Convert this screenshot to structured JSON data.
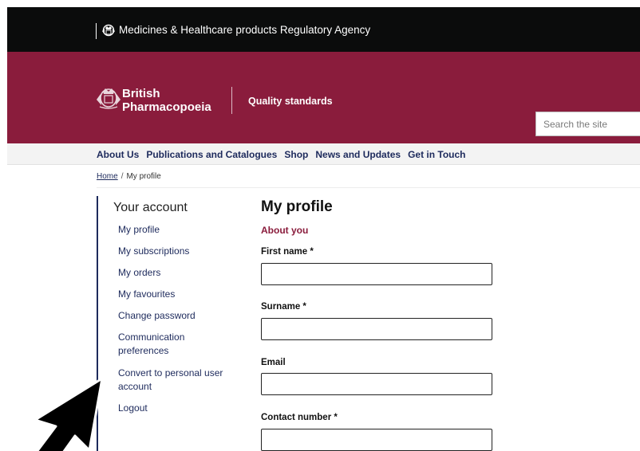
{
  "agency": {
    "name": "Medicines & Healthcare products Regulatory Agency"
  },
  "header": {
    "brand_line1": "British",
    "brand_line2": "Pharmacopoeia",
    "tagline": "Quality standards",
    "search_placeholder": "Search the site"
  },
  "nav": {
    "items": [
      {
        "label": "About Us"
      },
      {
        "label": "Publications and Catalogues"
      },
      {
        "label": "Shop"
      },
      {
        "label": "News and Updates"
      },
      {
        "label": "Get in Touch"
      }
    ]
  },
  "breadcrumb": {
    "home": "Home",
    "separator": "/",
    "current": "My profile"
  },
  "sidebar": {
    "title": "Your account",
    "items": [
      {
        "label": "My profile"
      },
      {
        "label": "My subscriptions"
      },
      {
        "label": "My orders"
      },
      {
        "label": "My favourites"
      },
      {
        "label": "Change password"
      },
      {
        "label": "Communication preferences"
      },
      {
        "label": "Convert to personal user account"
      },
      {
        "label": "Logout"
      }
    ]
  },
  "main": {
    "title": "My profile",
    "section": "About you",
    "fields": [
      {
        "label": "First name *",
        "value": ""
      },
      {
        "label": "Surname *",
        "value": ""
      },
      {
        "label": "Email",
        "value": ""
      },
      {
        "label": "Contact number *",
        "value": ""
      }
    ]
  },
  "colors": {
    "header_maroon": "#8a1c3c",
    "agency_black": "#0b0c0c",
    "link_navy": "#1d2a5c"
  },
  "icons": {
    "agency_crest": "royal-crest-icon",
    "brand_crest": "royal-crest-icon",
    "pointer": "mouse-cursor-icon"
  }
}
